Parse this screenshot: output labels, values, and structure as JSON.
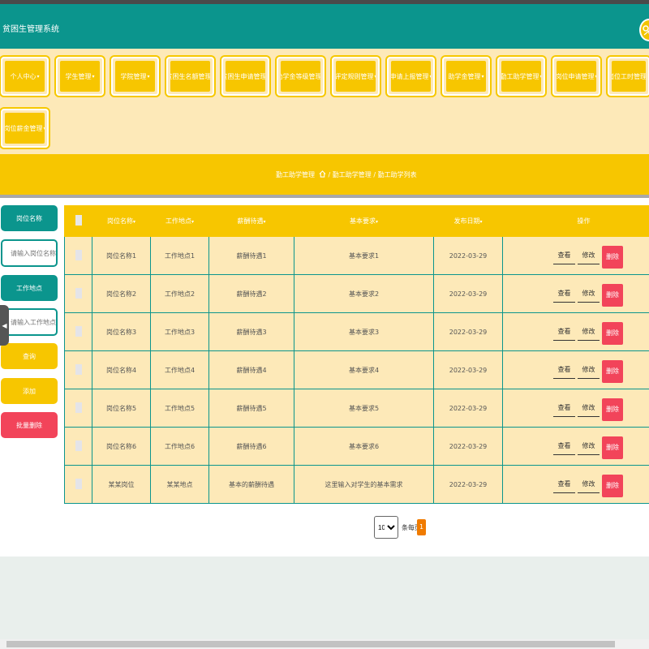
{
  "header": {
    "title": "贫困生管理系统"
  },
  "nav": {
    "items": [
      {
        "label": "个人中心"
      },
      {
        "label": "学生管理"
      },
      {
        "label": "学院管理"
      },
      {
        "label": "贫困生名额管理"
      },
      {
        "label": "贫困生申请管理"
      },
      {
        "label": "助学金等级管理"
      },
      {
        "label": "评定规则管理"
      },
      {
        "label": "申请上报管理"
      },
      {
        "label": "助学金管理"
      },
      {
        "label": "勤工助学管理"
      },
      {
        "label": "岗位申请管理"
      },
      {
        "label": "岗位工时管理"
      },
      {
        "label": "岗位薪金管理"
      }
    ]
  },
  "breadcrumb": {
    "section": "勤工助学管理",
    "path": "/ 勤工助学管理 / 勤工助学列表"
  },
  "sidebar": {
    "position_label": "岗位名称",
    "position_placeholder": "请输入岗位名称",
    "location_label": "工作地点",
    "location_placeholder": "请输入工作地点",
    "query_label": "查询",
    "add_label": "添加",
    "batch_delete_label": "批量删除"
  },
  "table": {
    "headers": {
      "position": "岗位名称",
      "location": "工作地点",
      "salary": "薪酬待遇",
      "requirement": "基本要求",
      "date": "发布日期",
      "ops": "操作"
    },
    "sort_icon": "sort-caret-icon",
    "rows": [
      {
        "position": "岗位名称1",
        "location": "工作地点1",
        "salary": "薪酬待遇1",
        "requirement": "基本要求1",
        "date": "2022-03-29"
      },
      {
        "position": "岗位名称2",
        "location": "工作地点2",
        "salary": "薪酬待遇2",
        "requirement": "基本要求2",
        "date": "2022-03-29"
      },
      {
        "position": "岗位名称3",
        "location": "工作地点3",
        "salary": "薪酬待遇3",
        "requirement": "基本要求3",
        "date": "2022-03-29"
      },
      {
        "position": "岗位名称4",
        "location": "工作地点4",
        "salary": "薪酬待遇4",
        "requirement": "基本要求4",
        "date": "2022-03-29"
      },
      {
        "position": "岗位名称5",
        "location": "工作地点5",
        "salary": "薪酬待遇5",
        "requirement": "基本要求5",
        "date": "2022-03-29"
      },
      {
        "position": "岗位名称6",
        "location": "工作地点6",
        "salary": "薪酬待遇6",
        "requirement": "基本要求6",
        "date": "2022-03-29"
      },
      {
        "position": "某某岗位",
        "location": "某某地点",
        "salary": "基本的薪酬待遇",
        "requirement": "这里输入对学生的基本需求",
        "date": "2022-03-29"
      }
    ],
    "actions": {
      "view": "查看",
      "edit": "修改",
      "delete": "删除"
    }
  },
  "pagination": {
    "page_size": "10",
    "page_size_options": [
      "10"
    ],
    "per_page_label": "条每页",
    "current_page": "1"
  },
  "colors": {
    "teal": "#0b958d",
    "yellow": "#f7c600",
    "cream": "#fde9b8",
    "red": "#f2445a",
    "orange": "#f07b00"
  }
}
